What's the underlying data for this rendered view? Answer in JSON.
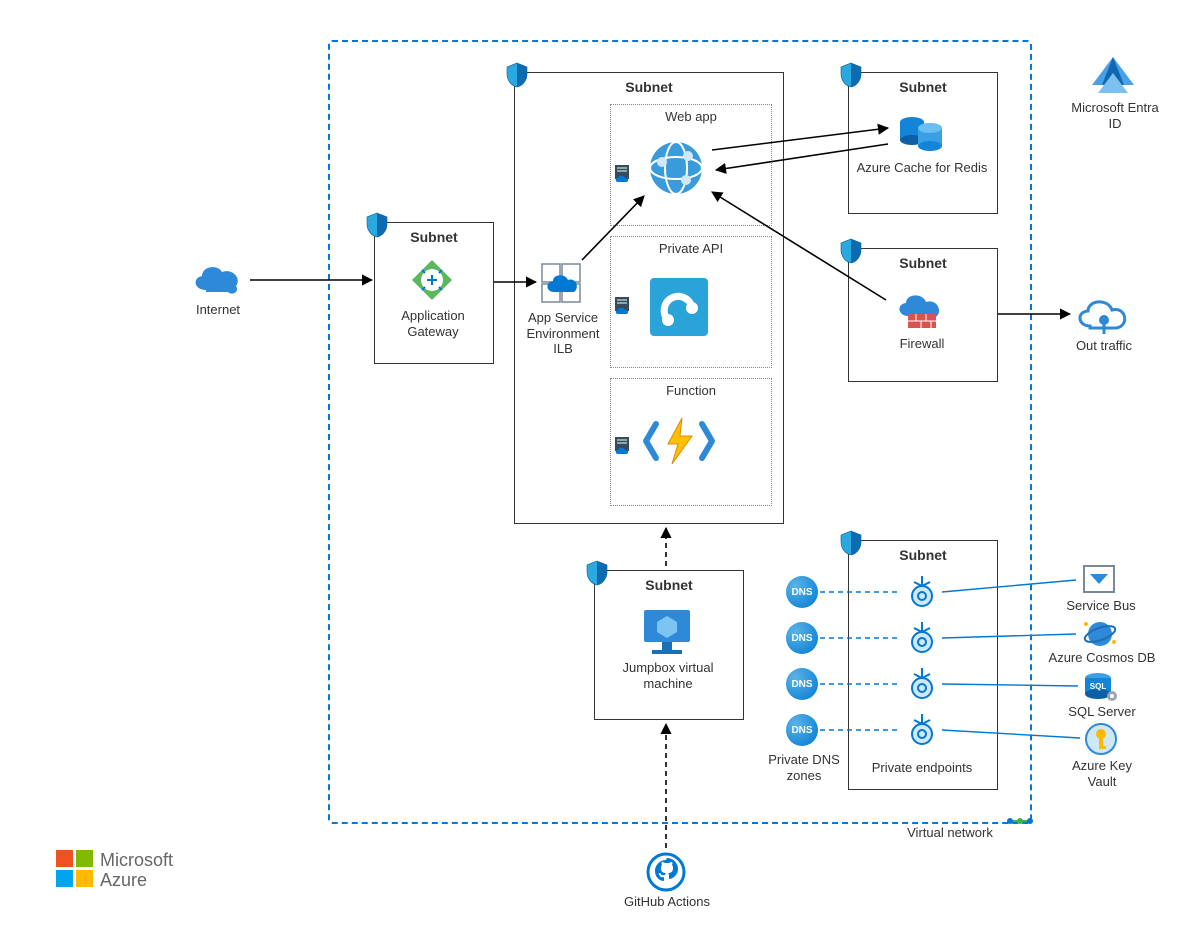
{
  "boundary": {
    "vnet_label": "Virtual network"
  },
  "external": {
    "internet": "Internet",
    "out_traffic": "Out traffic",
    "entra": "Microsoft Entra ID",
    "github": "GitHub Actions",
    "azure_brand_top": "Microsoft",
    "azure_brand_bottom": "Azure"
  },
  "subnets": {
    "appgw": {
      "title": "Subnet",
      "service": "Application Gateway"
    },
    "ase": {
      "title": "Subnet",
      "ilb": "App Service Environment ILB",
      "webapp": {
        "title": "Web app"
      },
      "api": {
        "title": "Private API"
      },
      "function": {
        "title": "Function"
      }
    },
    "redis": {
      "title": "Subnet",
      "service": "Azure Cache for Redis"
    },
    "firewall": {
      "title": "Subnet",
      "service": "Firewall"
    },
    "jumpbox": {
      "title": "Subnet",
      "service": "Jumpbox virtual machine"
    },
    "endpoints": {
      "title": "Subnet",
      "dns_label": "Private DNS zones",
      "dns_text": "DNS",
      "pe_label": "Private endpoints"
    }
  },
  "services": {
    "sbus": "Service Bus",
    "cosmos": "Azure Cosmos DB",
    "sql": "SQL Server",
    "kv": "Azure Key Vault"
  }
}
